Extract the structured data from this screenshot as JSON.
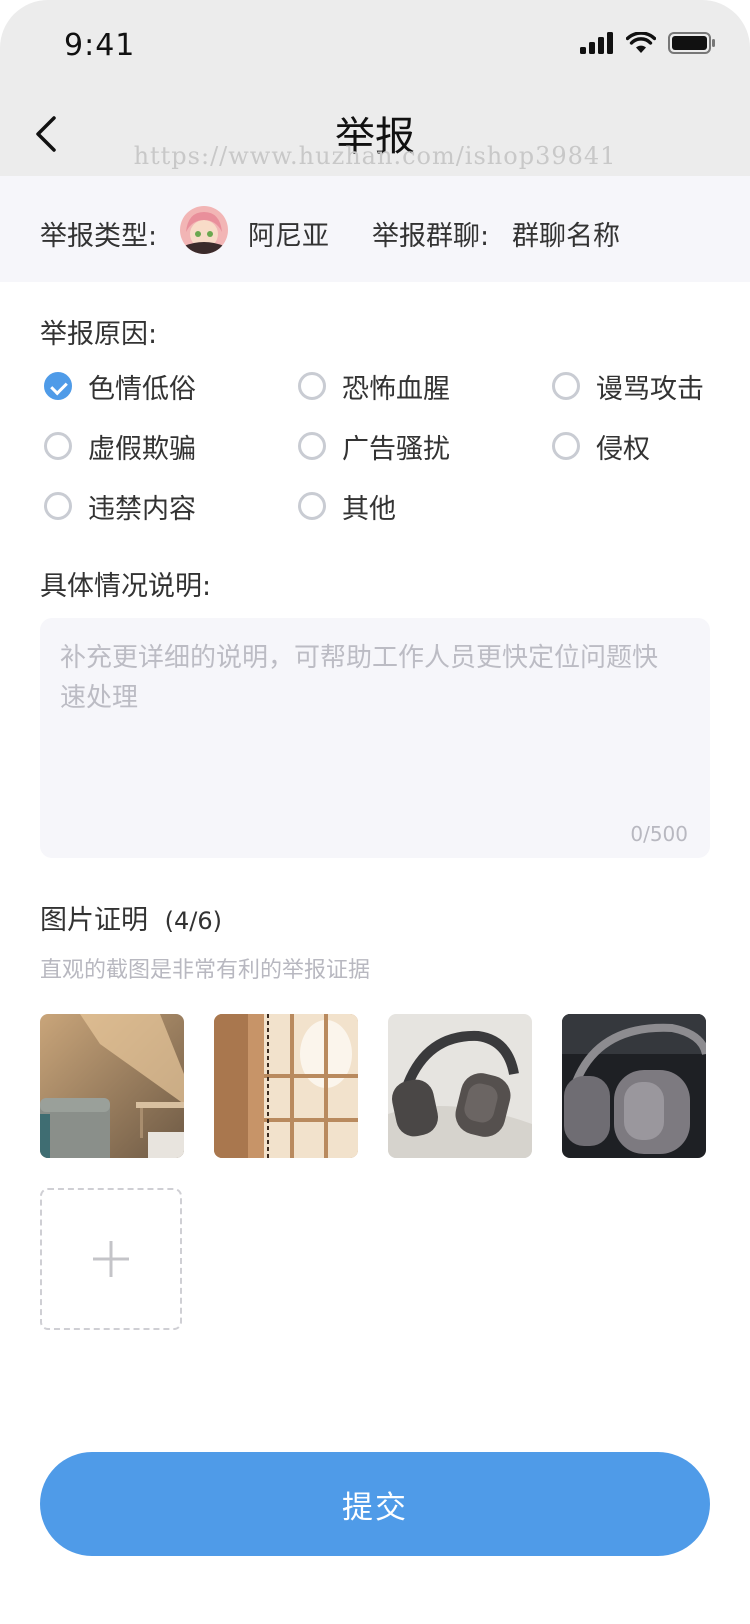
{
  "status_bar": {
    "time": "9:41"
  },
  "header": {
    "title": "举报",
    "watermark": "https://www.huzhan.com/ishop39841"
  },
  "info": {
    "report_type_label": "举报类型:",
    "user_name": "阿尼亚",
    "report_group_label": "举报群聊:",
    "group_name": "群聊名称"
  },
  "reasons": {
    "label": "举报原因:",
    "options": [
      {
        "label": "色情低俗",
        "checked": true
      },
      {
        "label": "恐怖血腥",
        "checked": false
      },
      {
        "label": "谩骂攻击",
        "checked": false
      },
      {
        "label": "虚假欺骗",
        "checked": false
      },
      {
        "label": "广告骚扰",
        "checked": false
      },
      {
        "label": "侵权",
        "checked": false
      },
      {
        "label": "违禁内容",
        "checked": false
      },
      {
        "label": "其他",
        "checked": false
      }
    ]
  },
  "details": {
    "label": "具体情况说明:",
    "placeholder": "补充更详细的说明，可帮助工作人员更快定位问题快速处理",
    "counter": "0/500"
  },
  "evidence": {
    "label": "图片证明",
    "count": "(4/6)",
    "hint": "直观的截图是非常有利的举报证据",
    "images": [
      "sunlit-room-photo",
      "window-photo",
      "headphones-on-bed-photo",
      "headphones-closeup-photo"
    ]
  },
  "submit_label": "提交",
  "colors": {
    "accent": "#4f9be8",
    "bar_bg": "#ececec",
    "panel_bg": "#f6f6fa"
  }
}
